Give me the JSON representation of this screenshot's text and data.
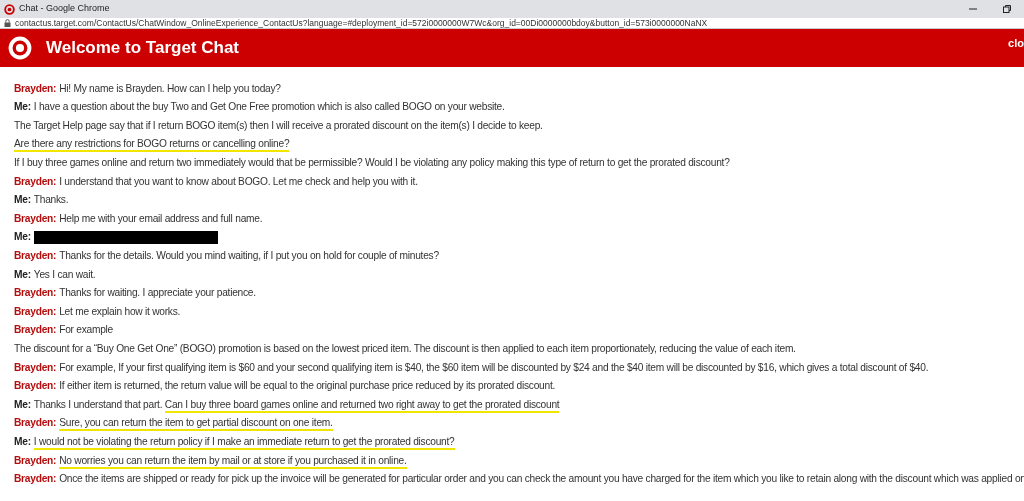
{
  "window": {
    "title": "Chat - Google Chrome",
    "url": "contactus.target.com/ContactUs/ChatWindow_OnlineExperience_ContactUs?language=#deployment_id=572i0000000W7Wc&org_id=00Di0000000bdoy&button_id=573i0000000NaNX"
  },
  "header": {
    "title": "Welcome to Target Chat",
    "close_label": "clo"
  },
  "messages": [
    {
      "kind": "agent",
      "speaker": "Brayden:",
      "lines": [
        [
          {
            "text": "Hi! My name is Brayden. How can I help you today?",
            "highlighted": false
          }
        ]
      ]
    },
    {
      "kind": "user",
      "speaker": "Me:",
      "lines": [
        [
          {
            "text": "I have a question about the buy Two and Get One Free promotion which is also called BOGO on your website.",
            "highlighted": false
          }
        ]
      ]
    },
    {
      "kind": "plain",
      "lines": [
        [
          {
            "text": "The Target Help page say that if I return BOGO item(s) then I will receive a prorated discount on the item(s) I decide to keep.",
            "highlighted": false
          }
        ]
      ]
    },
    {
      "kind": "plain",
      "lines": [
        [
          {
            "text": "Are there any restrictions for BOGO returns or cancelling online?",
            "highlighted": true
          }
        ]
      ]
    },
    {
      "kind": "plain",
      "lines": [
        [
          {
            "text": "If I buy three games online and return two immediately would that be permissible? Would I be violating any policy making this type of return to get the prorated discount?",
            "highlighted": false
          }
        ]
      ]
    },
    {
      "kind": "agent",
      "speaker": "Brayden:",
      "lines": [
        [
          {
            "text": "I understand that you want to know about BOGO. Let me check and help you with it.",
            "highlighted": false
          }
        ]
      ]
    },
    {
      "kind": "user",
      "speaker": "Me:",
      "lines": [
        [
          {
            "text": "Thanks.",
            "highlighted": false
          }
        ]
      ]
    },
    {
      "kind": "agent",
      "speaker": "Brayden:",
      "lines": [
        [
          {
            "text": "Help me with your email address and full name.",
            "highlighted": false
          }
        ]
      ]
    },
    {
      "kind": "user",
      "speaker": "Me:",
      "redacted": true
    },
    {
      "kind": "agent",
      "speaker": "Brayden:",
      "lines": [
        [
          {
            "text": "Thanks for the details. Would you mind waiting, if I put you on hold for couple of minutes?",
            "highlighted": false
          }
        ]
      ]
    },
    {
      "kind": "user",
      "speaker": "Me:",
      "lines": [
        [
          {
            "text": "Yes I can wait.",
            "highlighted": false
          }
        ]
      ]
    },
    {
      "kind": "agent",
      "speaker": "Brayden:",
      "lines": [
        [
          {
            "text": "Thanks for waiting. I appreciate your patience.",
            "highlighted": false
          }
        ]
      ]
    },
    {
      "kind": "agent",
      "speaker": "Brayden:",
      "lines": [
        [
          {
            "text": "Let me explain how it works.",
            "highlighted": false
          }
        ]
      ]
    },
    {
      "kind": "agent",
      "speaker": "Brayden:",
      "lines": [
        [
          {
            "text": "For example",
            "highlighted": false
          }
        ],
        [
          {
            "text": "The discount for a “Buy One Get One” (BOGO) promotion is based on the lowest priced item. The discount is then applied to each item proportionately, reducing the value of each item.",
            "highlighted": false
          }
        ]
      ]
    },
    {
      "kind": "agent",
      "speaker": "Brayden:",
      "lines": [
        [
          {
            "text": "For example, If your first qualifying item is $60 and your second qualifying item is $40, the $60 item will be discounted by $24 and the $40 item will be discounted by $16, which gives a total discount of $40.",
            "highlighted": false
          }
        ]
      ]
    },
    {
      "kind": "agent",
      "speaker": "Brayden:",
      "lines": [
        [
          {
            "text": "If either item is returned, the return value will be equal to the original purchase price reduced by its prorated discount.",
            "highlighted": false
          }
        ]
      ]
    },
    {
      "kind": "user",
      "speaker": "Me:",
      "lines": [
        [
          {
            "text": "Thanks I understand that part. ",
            "highlighted": false
          },
          {
            "text": "Can I buy three board games online and returned two right away to get the prorated discount ",
            "highlighted": true
          }
        ]
      ]
    },
    {
      "kind": "agent",
      "speaker": "Brayden:",
      "lines": [
        [
          {
            "text": "Sure, you can return the item to get partial discount on one item.",
            "highlighted": true
          }
        ]
      ]
    },
    {
      "kind": "user",
      "speaker": "Me:",
      "lines": [
        [
          {
            "text": "I would not be violating the return policy if I make an immediate return to get the prorated discount?",
            "highlighted": true
          }
        ]
      ]
    },
    {
      "kind": "agent",
      "speaker": "Brayden:",
      "lines": [
        [
          {
            "text": "No worries you can return the item by mail or at store if you purchased it in online.",
            "highlighted": true
          }
        ]
      ]
    },
    {
      "kind": "agent",
      "speaker": "Brayden:",
      "lines": [
        [
          {
            "text": "Once the items are shipped or ready for pick up the invoice will be generated for particular order and you can check the amount you have charged for the item which you like to retain along with the discount which was applied on",
            "highlighted": false
          }
        ]
      ]
    }
  ]
}
